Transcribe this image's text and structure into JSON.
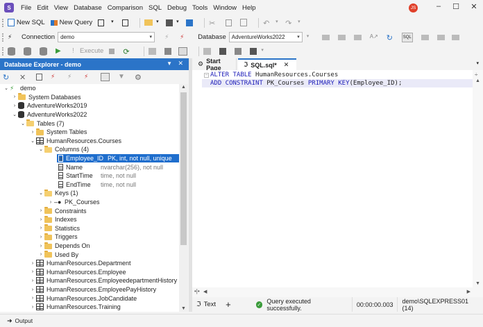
{
  "menu": [
    "File",
    "Edit",
    "View",
    "Database",
    "Comparison",
    "SQL",
    "Debug",
    "Tools",
    "Window",
    "Help"
  ],
  "user_initials": "JS",
  "toolbar1": {
    "new_sql": "New SQL",
    "new_query": "New Query"
  },
  "toolbar2": {
    "connection_label": "Connection",
    "connection_value": "demo",
    "database_label": "Database",
    "database_value": "AdventureWorks2022"
  },
  "toolbar3": {
    "execute": "Execute"
  },
  "explorer": {
    "title": "Database Explorer - demo",
    "tree": [
      {
        "label": "demo",
        "icon": "server-icon"
      },
      {
        "label": "System Databases",
        "icon": "folder-icon"
      },
      {
        "label": "AdventureWorks2019",
        "icon": "database-icon"
      },
      {
        "label": "AdventureWorks2022",
        "icon": "database-icon"
      },
      {
        "label": "Tables (7)",
        "icon": "folder-open-icon"
      },
      {
        "label": "System Tables",
        "icon": "folder-icon"
      },
      {
        "label": "HumanResources.Courses",
        "icon": "table-icon"
      },
      {
        "label": "Columns (4)",
        "icon": "folder-open-icon"
      },
      {
        "label": "Employee_ID",
        "type": "PK, int, not null, unique",
        "icon": "primary-key-column-icon"
      },
      {
        "label": "Name",
        "type": "nvarchar(256), not null",
        "icon": "column-icon"
      },
      {
        "label": "StartTime",
        "type": "time, not null",
        "icon": "column-icon"
      },
      {
        "label": "EndTime",
        "type": "time, not null",
        "icon": "column-icon"
      },
      {
        "label": "Keys (1)",
        "icon": "folder-open-icon"
      },
      {
        "label": "PK_Courses",
        "icon": "key-icon"
      },
      {
        "label": "Constraints",
        "icon": "folder-icon"
      },
      {
        "label": "Indexes",
        "icon": "folder-icon"
      },
      {
        "label": "Statistics",
        "icon": "folder-icon"
      },
      {
        "label": "Triggers",
        "icon": "folder-icon"
      },
      {
        "label": "Depends On",
        "icon": "folder-icon"
      },
      {
        "label": "Used By",
        "icon": "folder-icon"
      },
      {
        "label": "HumanResources.Department",
        "icon": "table-icon"
      },
      {
        "label": "HumanResources.Employee",
        "icon": "table-icon"
      },
      {
        "label": "HumanResources.EmployeedepartmentHistory",
        "icon": "table-icon"
      },
      {
        "label": "HumanResources.EmployeePayHistory",
        "icon": "table-icon"
      },
      {
        "label": "HumanResources.JobCandidate",
        "icon": "table-icon"
      },
      {
        "label": "HumanResources.Training",
        "icon": "table-icon"
      }
    ]
  },
  "tabs": {
    "start_page": "Start Page",
    "sql_tab": "SQL.sql*"
  },
  "editor": {
    "line1_kw": "ALTER TABLE ",
    "line1_rest": "HumanResources.Courses",
    "line2_kw1": "ADD CONSTRAINT ",
    "line2_name": "PK_Courses ",
    "line2_kw2": "PRIMARY KEY",
    "line2_rest": "(Employee_ID);"
  },
  "status": {
    "text_tab": "Text",
    "message": "Query executed successfully.",
    "elapsed": "00:00:00.003",
    "server": "demo\\SQLEXPRESS01 (14)"
  },
  "output": {
    "label": "Output"
  },
  "colors": {
    "accent": "#2b74c8",
    "selection": "#1f6ecd",
    "keyword": "#1b1bb8",
    "success": "#3a9b3a"
  }
}
